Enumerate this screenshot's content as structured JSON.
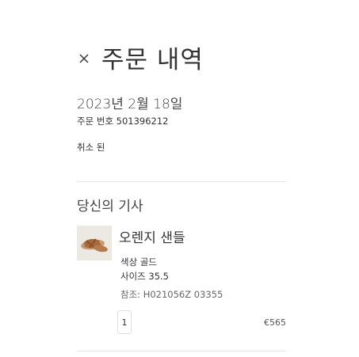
{
  "header": {
    "title": "주문 내역"
  },
  "order": {
    "date": "2023년 2월 18일",
    "number_text": "주문 번호 501396212",
    "status": "취소 된"
  },
  "items_section": {
    "title": "당신의 기사"
  },
  "item": {
    "name": "오렌지 샌들",
    "color_text": "색상 골드",
    "size_text": "사이즈 35.5",
    "reference_text": "참조: H021056Z 03355",
    "quantity": "1",
    "price": "€565"
  },
  "colors": {
    "text": "#333333",
    "divider": "#e5e5e5",
    "thumb_background": "#ece8e2",
    "sandal": "#b0784a"
  },
  "icons": {
    "close": "close-icon"
  }
}
